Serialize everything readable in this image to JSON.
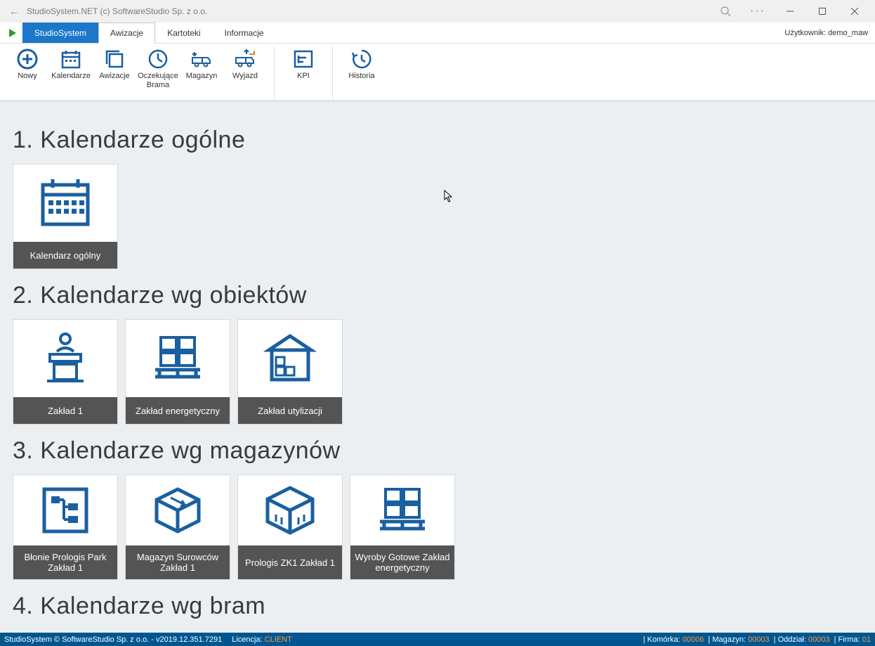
{
  "window": {
    "title": "StudioSystem.NET (c) SoftwareStudio Sp. z o.o."
  },
  "menu": {
    "primary": "StudioSystem",
    "tabs": [
      "Awizacje",
      "Kartoteki",
      "Informacje"
    ],
    "active_index": 0,
    "user_label": "Użytkownik: demo_maw"
  },
  "ribbon": {
    "groups": [
      {
        "items": [
          {
            "label": "Nowy",
            "icon": "plus-circle-icon"
          },
          {
            "label": "Kalendarze",
            "icon": "calendar-icon"
          },
          {
            "label": "Awizacje",
            "icon": "copies-icon"
          },
          {
            "label": "Oczekujące Brama",
            "icon": "clock-icon"
          },
          {
            "label": "Magazyn",
            "icon": "truck-in-icon"
          },
          {
            "label": "Wyjazd",
            "icon": "truck-out-icon"
          }
        ]
      },
      {
        "items": [
          {
            "label": "KPI",
            "icon": "kpi-icon"
          }
        ]
      },
      {
        "items": [
          {
            "label": "Historia",
            "icon": "history-icon"
          }
        ]
      }
    ]
  },
  "sections": [
    {
      "title": "1. Kalendarze ogólne",
      "tiles": [
        {
          "label": "Kalendarz ogólny",
          "icon": "calendar-big-icon"
        }
      ]
    },
    {
      "title": "2. Kalendarze wg obiektów",
      "tiles": [
        {
          "label": "Zakład 1",
          "icon": "podium-icon"
        },
        {
          "label": "Zakład energetyczny",
          "icon": "pallet-boxes-icon"
        },
        {
          "label": "Zakład utylizacji",
          "icon": "warehouse-icon"
        }
      ]
    },
    {
      "title": "3. Kalendarze wg magazynów",
      "tiles": [
        {
          "label": "Błonie Prologis Park Zakład 1",
          "icon": "flow-icon",
          "two": true
        },
        {
          "label": "Magazyn Surowców Zakład 1",
          "icon": "box-open-icon",
          "two": true
        },
        {
          "label": "Prologis ZK1 Zakład 1",
          "icon": "cube-icon",
          "two": true
        },
        {
          "label": "Wyroby Gotowe Zakład energetyczny",
          "icon": "pallet-boxes-icon",
          "two": true
        }
      ]
    },
    {
      "title": "4. Kalendarze wg bram",
      "tiles": []
    }
  ],
  "status": {
    "left": "StudioSystem © SoftwareStudio Sp. z o.o. - v2019.12.351.7291",
    "license_label": "Licencja:",
    "license_value": "CLIENT",
    "right": [
      {
        "label": "Komórka:",
        "value": "00006"
      },
      {
        "label": "Magazyn:",
        "value": "00003"
      },
      {
        "label": "Oddział:",
        "value": "00003"
      },
      {
        "label": "Firma:",
        "value": "01"
      }
    ]
  }
}
